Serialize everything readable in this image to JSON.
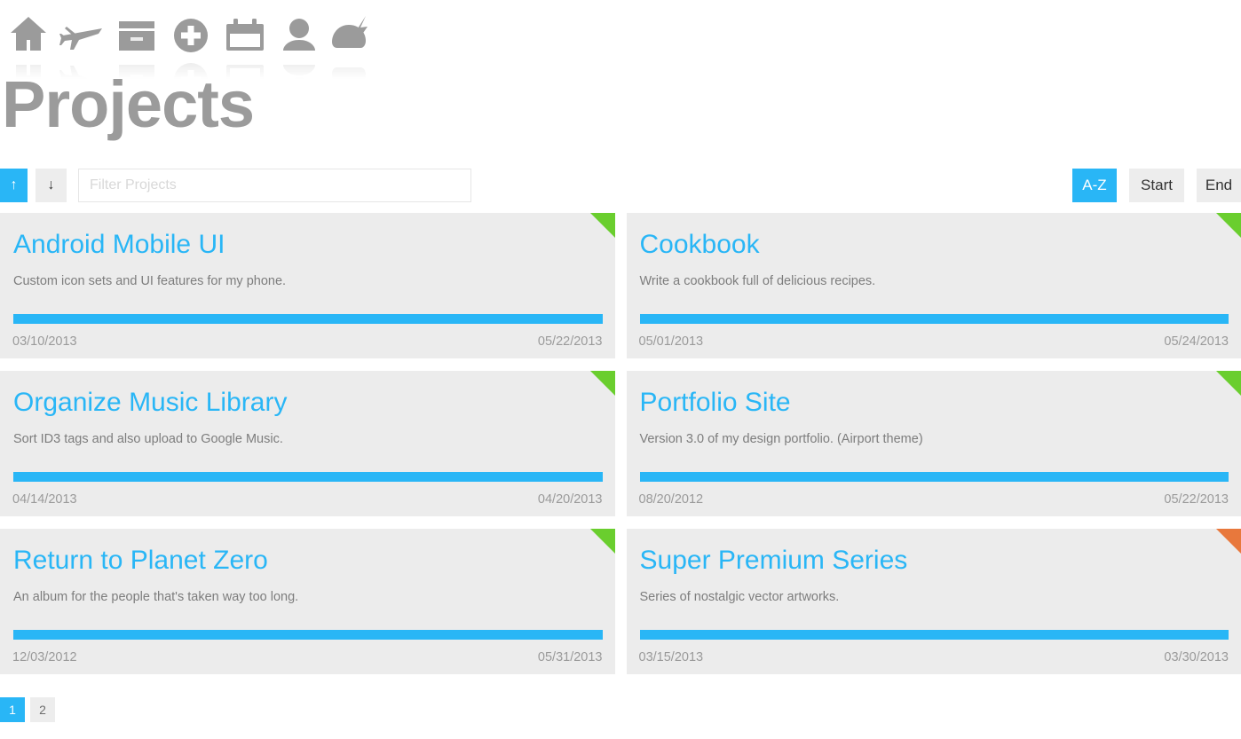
{
  "masthead": {
    "title": "Projects",
    "icons": [
      {
        "name": "home-icon",
        "label": "Home"
      },
      {
        "name": "airplane-icon",
        "label": "Travel"
      },
      {
        "name": "archive-box-icon",
        "label": "Archive"
      },
      {
        "name": "plus-circle-icon",
        "label": "Add"
      },
      {
        "name": "calendar-icon",
        "label": "Calendar"
      },
      {
        "name": "user-icon",
        "label": "Profile"
      },
      {
        "name": "storm-cloud-icon",
        "label": "Weather"
      }
    ]
  },
  "toolbar": {
    "sort_asc_label": "↑",
    "sort_desc_label": "↓",
    "filter_placeholder": "Filter Projects",
    "filter_value": "",
    "sort_az_label": "A-Z",
    "sort_start_label": "Start",
    "sort_end_label": "End",
    "active_direction": "asc",
    "active_sort": "A-Z"
  },
  "colors": {
    "accent_blue": "#29b6f6",
    "flag_green": "#6ace2e",
    "flag_orange": "#e8783c",
    "card_bg": "#ececec",
    "title_gray": "#9b9b9b",
    "button_gray": "#ededed"
  },
  "projects": [
    {
      "title": "Android Mobile UI",
      "description": "Custom icon sets and UI features for my phone.",
      "start_date": "03/10/2013",
      "end_date": "05/22/2013",
      "progress": 100,
      "flag_color": "green"
    },
    {
      "title": "Cookbook",
      "description": "Write a cookbook full of delicious recipes.",
      "start_date": "05/01/2013",
      "end_date": "05/24/2013",
      "progress": 100,
      "flag_color": "green"
    },
    {
      "title": "Organize Music Library",
      "description": "Sort ID3 tags and also upload to Google Music.",
      "start_date": "04/14/2013",
      "end_date": "04/20/2013",
      "progress": 100,
      "flag_color": "green"
    },
    {
      "title": "Portfolio Site",
      "description": "Version 3.0 of my design portfolio. (Airport theme)",
      "start_date": "08/20/2012",
      "end_date": "05/22/2013",
      "progress": 100,
      "flag_color": "green"
    },
    {
      "title": "Return to Planet Zero",
      "description": "An album for the people that's taken way too long.",
      "start_date": "12/03/2012",
      "end_date": "05/31/2013",
      "progress": 100,
      "flag_color": "green"
    },
    {
      "title": "Super Premium Series",
      "description": "Series of nostalgic vector artworks.",
      "start_date": "03/15/2013",
      "end_date": "03/30/2013",
      "progress": 100,
      "flag_color": "orange"
    }
  ],
  "pagination": {
    "pages": [
      "1",
      "2"
    ],
    "current": "1"
  }
}
